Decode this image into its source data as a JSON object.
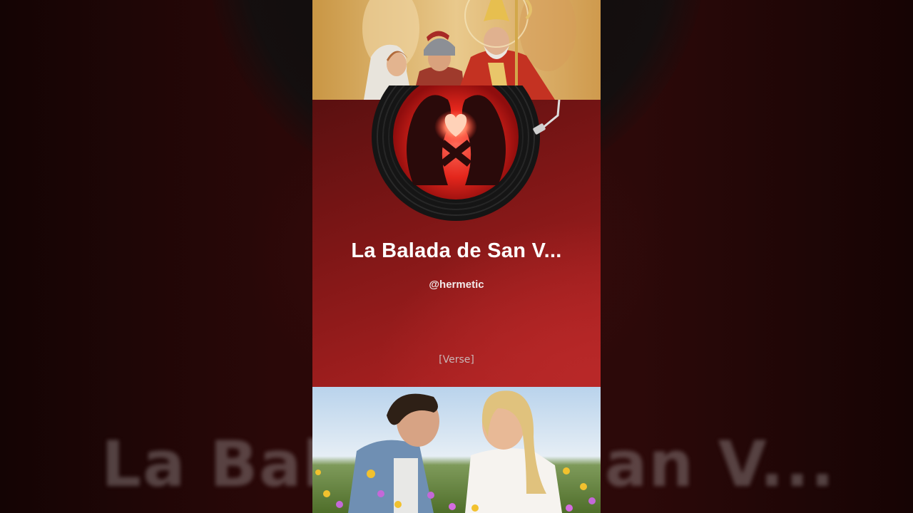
{
  "song": {
    "title": "La Balada de San V...",
    "artist": "@hermetic",
    "lyric": "[Verse]"
  },
  "background": {
    "ghost_left": "La Bal",
    "ghost_right": "an V..."
  },
  "images": {
    "top": "saint-icon-painting",
    "bottom": "couple-in-flower-field",
    "vinyl_label": "heart-silhouette-art"
  },
  "colors": {
    "card_dark": "#5a1010",
    "card_light": "#b52626",
    "text": "#ffffff"
  }
}
